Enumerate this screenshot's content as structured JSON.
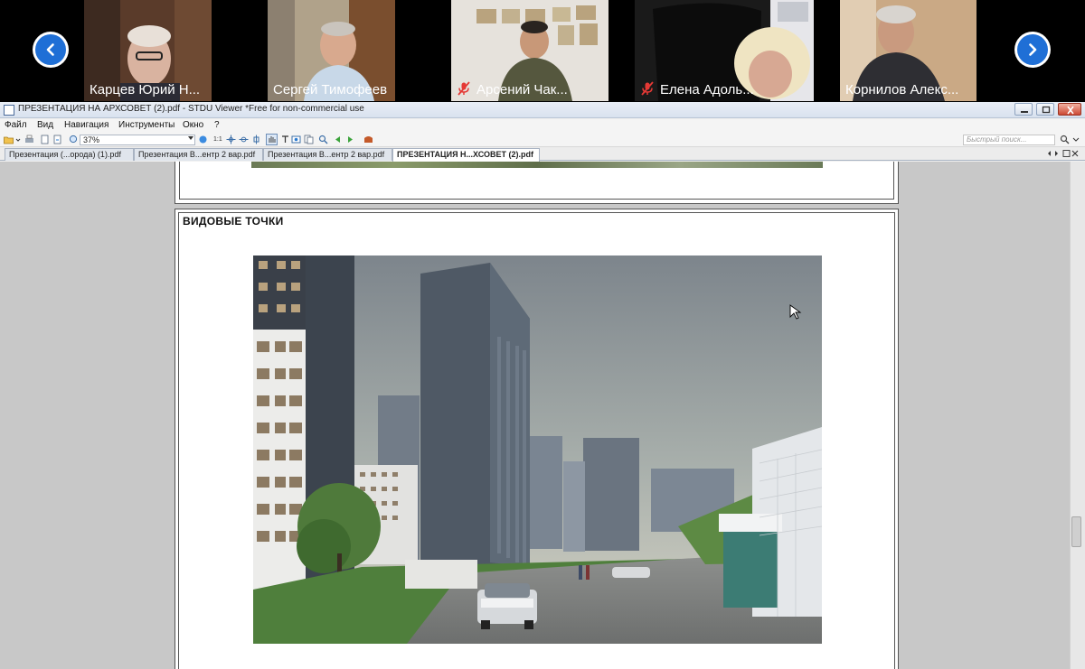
{
  "participants": [
    {
      "name": "Карцев Юрий Н...",
      "muted": false
    },
    {
      "name": "Сергей Тимофеев",
      "muted": false
    },
    {
      "name": "Арсений Чак...",
      "muted": true
    },
    {
      "name": "Елена Адоль...",
      "muted": true
    },
    {
      "name": "Корнилов Алекс...",
      "muted": false
    }
  ],
  "window": {
    "title": "ПРЕЗЕНТАЦИЯ НА АРХСОВЕТ (2).pdf - STDU Viewer *Free for non-commercial use"
  },
  "menu": [
    "Файл",
    "Вид",
    "Навигация",
    "Инструменты",
    "Окно",
    "?"
  ],
  "toolbar": {
    "zoom_value": "37%",
    "search_placeholder": "Быстрый поиск..."
  },
  "tabs": [
    {
      "label": "Презентация (...орода) (1).pdf",
      "active": false
    },
    {
      "label": "Презентация В...ентр 2 вар.pdf",
      "active": false
    },
    {
      "label": "Презентация В...ентр 2 вар.pdf",
      "active": false
    },
    {
      "label": "ПРЕЗЕНТАЦИЯ Н...ХСОВЕТ (2).pdf",
      "active": true
    }
  ],
  "document": {
    "heading": "ВИДОВЫЕ ТОЧКИ"
  },
  "colors": {
    "nav_arrow": "#1f6fd6",
    "mic_muted": "#e53935"
  }
}
